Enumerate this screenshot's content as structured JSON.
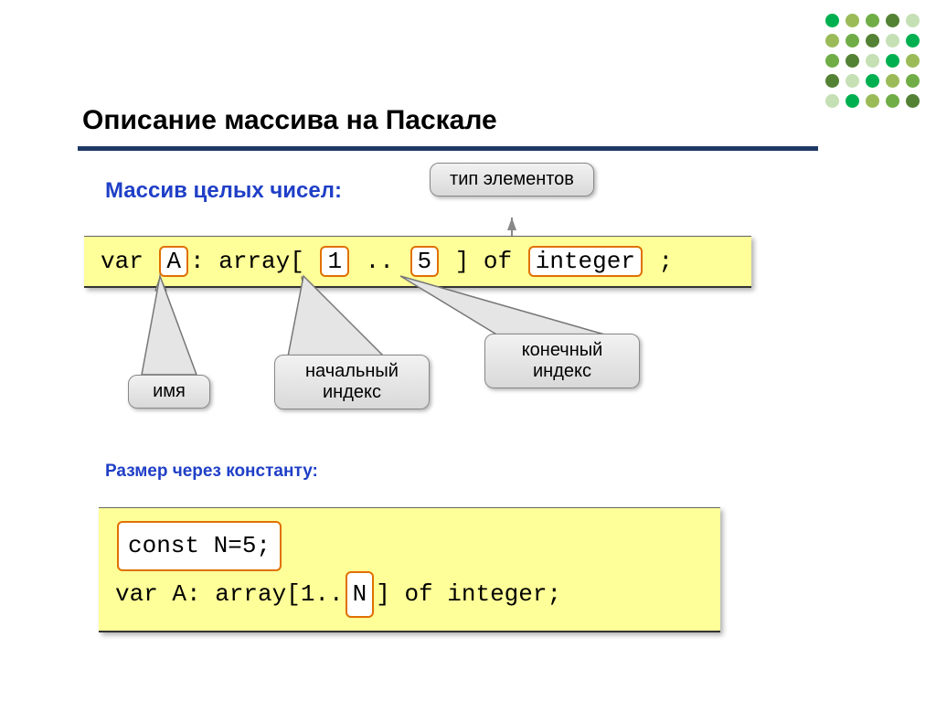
{
  "title": "Описание массива на Паскале",
  "subtitle1": "Массив целых чисел:",
  "bubbles": {
    "type": "тип элементов",
    "name": "имя",
    "start": "начальный индекс",
    "end": "конечный индекс"
  },
  "code1": {
    "pre": "var ",
    "tok_a": "A",
    "mid1": ": array[ ",
    "tok_1": "1",
    "mid2": " .. ",
    "tok_5": "5",
    "mid3": " ] of ",
    "tok_int": "integer",
    "tail": " ;"
  },
  "subtitle2": "Размер через константу:",
  "code2": {
    "line1": "const N=5;",
    "line2_a": "var A: array[1..",
    "line2_tok": "N",
    "line2_b": "] of integer;"
  }
}
